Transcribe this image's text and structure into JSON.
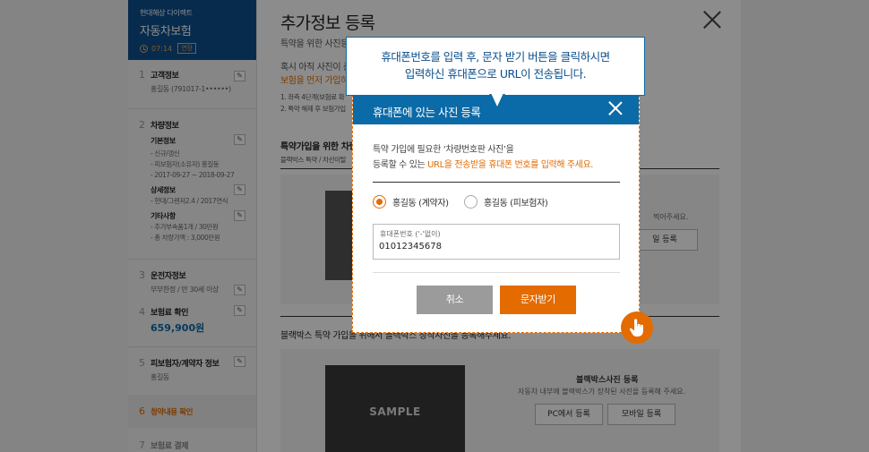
{
  "sidebar": {
    "brand": "현대해상 다이렉트",
    "product": "자동차보험",
    "timer": "07:14",
    "extend_label": "연장",
    "step1": {
      "num": "1",
      "title": "고객정보",
      "sub": "홍길동 (791017-1••••••)"
    },
    "step2": {
      "num": "2",
      "title": "차량정보",
      "basic_title": "기본정보",
      "basic_lines": [
        "- 신규/갱신",
        "- 피보험자(소유자) 홍길동",
        "- 2017-09-27 ~ 2018-09-27"
      ],
      "detail_title": "상세정보",
      "detail_lines": [
        "- 현대/그랜저2.4 / 2017연식"
      ],
      "other_title": "기타사항",
      "other_lines": [
        "- 추가부속품1개 / 30만원",
        "- 총 차량가액 : 3,000만원"
      ]
    },
    "step3": {
      "num": "3",
      "title": "운전자정보",
      "sub": "부부한정 / 만 30세 이상"
    },
    "step4": {
      "num": "4",
      "title": "보험료 확인",
      "price": "659,900원"
    },
    "step5": {
      "num": "5",
      "title": "피보험자/계약자 정보",
      "sub": "홍길동"
    },
    "step6": {
      "num": "6",
      "title": "청약내용 확인"
    },
    "step7": {
      "num": "7",
      "title": "보험료 결제"
    },
    "edit_glyph": "✎"
  },
  "content": {
    "title": "추가정보 등록",
    "line1": "특약을 위한 사진등",
    "line2": "혹시 아직 사진이 준",
    "line3": "보험을 먼저 가입하",
    "note1": "1. 좌측 4단계(보험료 확",
    "note2": "2. 특약 해제 후 보험가입",
    "section1_title": "특약가입을 위한 차량",
    "section1_desc": "블랙박스 특약 / 차선이탈",
    "photo_hint": "찍어주세요.",
    "mobile_btn_top": "일 등록",
    "section2_title": "블랙박스 특약 가입을 위해서 블랙박스 장착사진을 등록해주세요.",
    "sample_label": "SAMPLE",
    "bb_title": "블랙박스사진 등록",
    "bb_desc": "자동차 내부에 블랙박스가 장착된 사진을 등록해 주세요.",
    "pc_btn": "PC에서 등록",
    "mobile_btn": "모바일 등록"
  },
  "tooltip": {
    "line1": "휴대폰번호를 입력 후, 문자 받기 버튼을 클릭하시면",
    "line2": "입력하신 휴대폰으로 URL이 전송됩니다."
  },
  "modal": {
    "title": "휴대폰에 있는 사진 등록",
    "desc_line1": "특약 가입에 필요한 ‘차량번호판 사진’을",
    "desc_line2_a": "등록할 수 있는 ",
    "desc_line2_b": "URL을 전송받을 휴대폰 번호를 입력해 주세요.",
    "radio_contractor": "홍길동 (계약자)",
    "radio_insured": "홍길동 (피보험자)",
    "phone_label": "휴대폰번호 ('-'없이)",
    "phone_value": "01012345678",
    "cancel_label": "취소",
    "sms_label": "문자받기"
  },
  "colors": {
    "brand_blue": "#0b6aa8",
    "accent_orange": "#e46b00"
  },
  "icons": {
    "close": "close-icon",
    "touch": "hand-pointer-icon",
    "clock": "clock-icon",
    "edit": "pencil-icon"
  }
}
